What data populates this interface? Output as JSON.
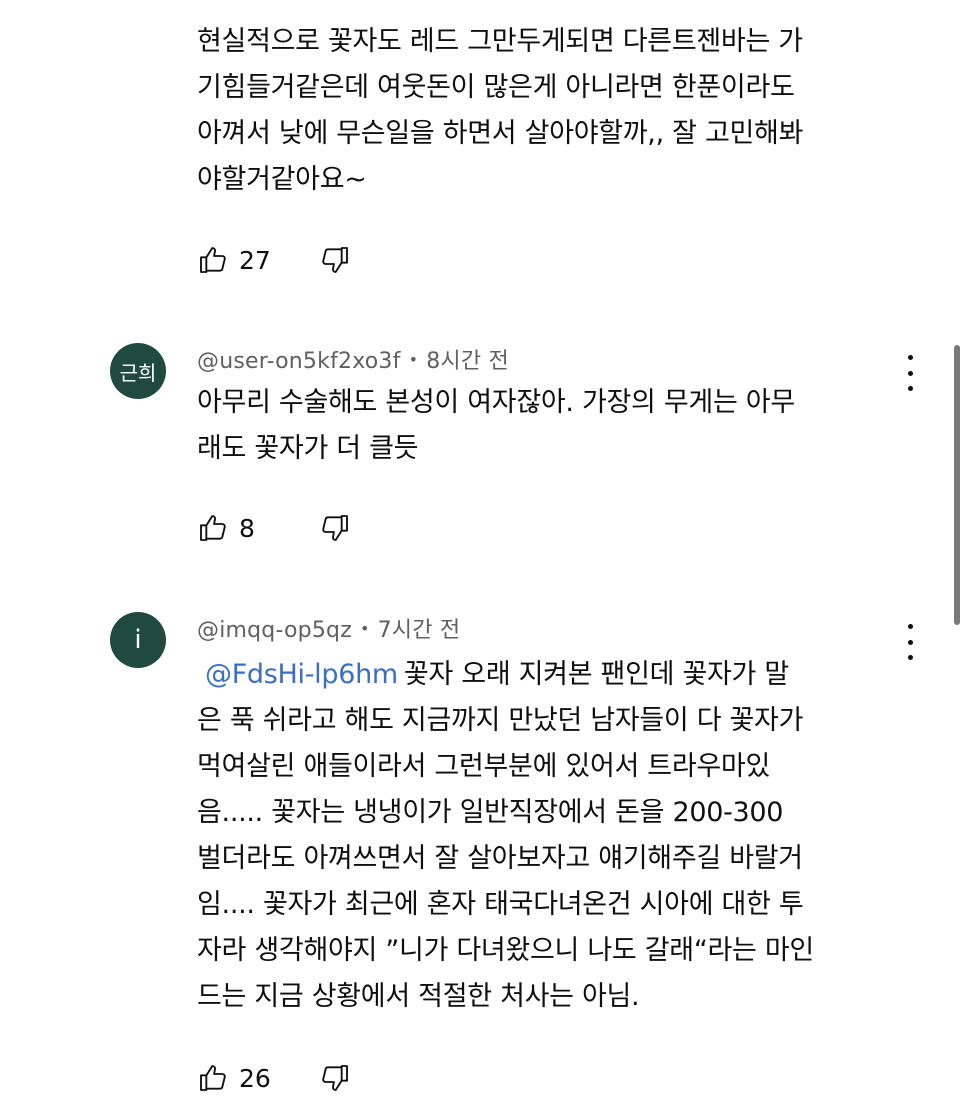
{
  "comments": [
    {
      "author": "",
      "time": "",
      "lines": [
        "현실적으로 꽃자도 레드 그만두게되면 다른트젠바는 가",
        "기힘들거같은데 여웃돈이 많은게 아니라면 한푼이라도",
        "아껴서 낮에 무슨일을 하면서 살아야할까,, 잘 고민해봐",
        "야할거같아요~"
      ],
      "likes": "27"
    },
    {
      "avatar_text": "근희",
      "author": "@user-on5kf2xo3f",
      "separator": "•",
      "time": "8시간 전",
      "lines": [
        "아무리 수술해도 본성이 여자잖아. 가장의 무게는 아무",
        "래도 꽃자가 더 클듯"
      ],
      "likes": "8"
    },
    {
      "avatar_text": "i",
      "author": "@imqq-op5qz",
      "separator": "•",
      "time": "7시간 전",
      "mention": "@FdsHi-lp6hm",
      "first_line_rest": "꽃자 오래 지켜본 팬인데 꽃자가 말",
      "lines": [
        "은 푹 쉬라고 해도 지금까지 만났던 남자들이 다 꽃자가",
        "먹여살린 애들이라서 그런부분에 있어서 트라우마있",
        "음..... 꽃자는 냉냉이가 일반직장에서 돈을 200-300",
        "벌더라도 아껴쓰면서 잘 살아보자고 얘기해주길 바랄거",
        "임.... 꽃자가 최근에 혼자 태국다녀온건 시아에 대한 투",
        "자라 생각해야지 ”니가 다녀왔으니 나도 갈래“라는 마인",
        "드는 지금 상황에서 적절한 처사는 아님."
      ],
      "likes": "26"
    }
  ],
  "icons": {
    "like": "thumbs-up-outline-icon",
    "dislike": "thumbs-down-outline-icon",
    "more": "more-vertical-icon"
  },
  "colors": {
    "text": "#0f0f0f",
    "meta": "#606060",
    "mention": "#3b6fc2",
    "avatar_bg": "#1f4a3d"
  }
}
